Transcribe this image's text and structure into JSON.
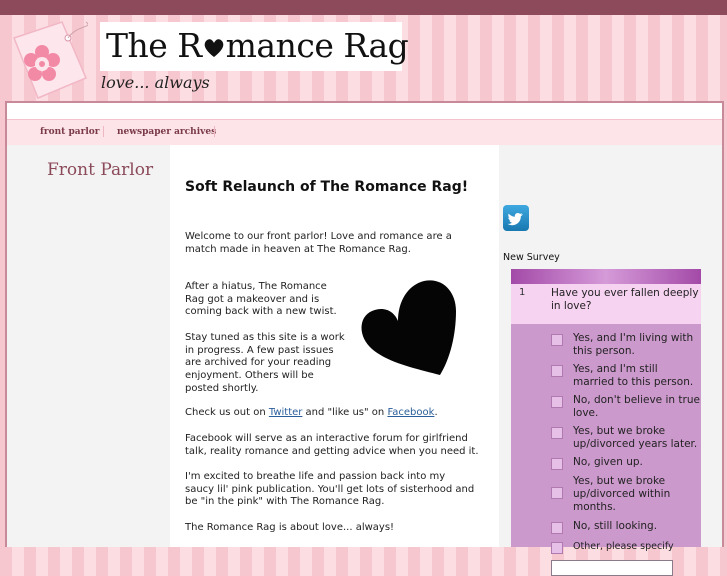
{
  "header": {
    "site_title": "The Romance Rag",
    "title_prefix": "The R",
    "title_suffix": "mance Rag",
    "tagline": "love... always"
  },
  "nav": {
    "items": [
      {
        "label": "front parlor"
      },
      {
        "label": "newspaper archives"
      }
    ]
  },
  "sidebar_left": {
    "title": "Front Parlor"
  },
  "post": {
    "title": "Soft Relaunch of The Romance Rag!",
    "intro": "Welcome to our front parlor! Love and romance are a match made in heaven at The Romance Rag.",
    "makeover": "After a hiatus, The Romance Rag got a makeover and is coming back with a new twist.",
    "progress": "Stay tuned as this site is a work in progress.  A few past issues are archived for your reading enjoyment. Others will be posted shortly.",
    "checkout_prefix": "Check us out on ",
    "twitter_link": "Twitter",
    "checkout_middle": " and \"like us\" on ",
    "facebook_link": "Facebook",
    "checkout_suffix": ".",
    "facebook_text": "Facebook will serve as an interactive forum for girlfriend talk, reality romance and getting advice when you need it.",
    "excited_text": "I'm excited to breathe life and passion back into my saucy lil' pink publication.  You'll get lots of sisterhood and be \"in the pink\" with The Romance Rag.",
    "closing": "The Romance Rag is about love... always!"
  },
  "sidebar_right": {
    "twitter_icon": "twitter-bird-icon",
    "survey_label": "New Survey",
    "survey": {
      "question_number": "1",
      "question": "Have you ever fallen deeply in love?",
      "options": [
        "Yes, and I'm living with this person.",
        "Yes, and I'm still married to this person.",
        "No, don't believe in true love.",
        "Yes, but we broke up/divorced years later.",
        "No, given up.",
        "Yes, but we broke up/divorced within months.",
        "No, still looking.",
        "Other, please specify"
      ],
      "other_value": ""
    }
  },
  "colors": {
    "topbar": "#8c4a5a",
    "stripe_light": "#fbdde2",
    "stripe_dark": "#f7c7cf",
    "survey_bg": "#cc99cc",
    "accent_title": "#8b4a5a"
  }
}
